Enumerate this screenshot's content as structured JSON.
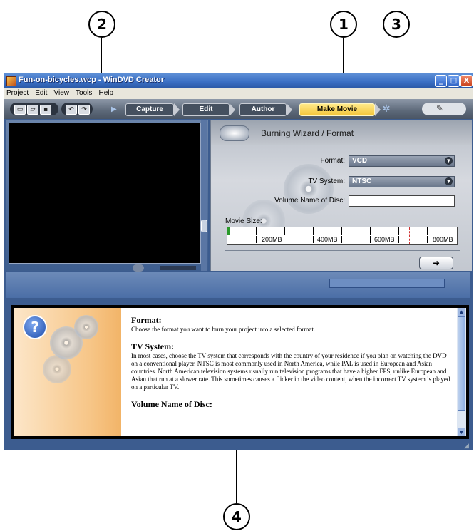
{
  "callouts": [
    "1",
    "2",
    "3",
    "4"
  ],
  "window": {
    "title": "Fun-on-bicycles.wcp - WinDVD Creator",
    "buttons": {
      "minimize": "_",
      "maximize": "□",
      "close": "X"
    }
  },
  "menu": [
    "Project",
    "Edit",
    "View",
    "Tools",
    "Help"
  ],
  "toolbar": {
    "file_buttons": [
      "new-icon",
      "open-icon",
      "save-icon"
    ],
    "undo_icon": "undo-icon",
    "redo_icon": "redo-icon",
    "steps": [
      {
        "label": "Capture",
        "active": false
      },
      {
        "label": "Edit",
        "active": false
      },
      {
        "label": "Author",
        "active": false
      },
      {
        "label": "Make Movie",
        "active": true
      }
    ]
  },
  "wizard": {
    "title": "Burning Wizard / Format",
    "format_label": "Format:",
    "format_value": "VCD",
    "tv_label": "TV System:",
    "tv_value": "NTSC",
    "volume_label": "Volume Name of Disc:",
    "volume_value": "",
    "movie_size_label": "Movie Size:",
    "size_marks": [
      "200MB",
      "400MB",
      "600MB",
      "800MB"
    ],
    "next_symbol": "➜"
  },
  "help": {
    "sections": [
      {
        "heading": "Format:",
        "body": "Choose the format you want to burn your project into a selected format."
      },
      {
        "heading": "TV System:",
        "body": "In most cases, choose the TV system that corresponds with the country of your residence if you plan on watching the DVD on a conventional player. NTSC is most commonly used in North America, while PAL is used in European and Asian countries. North American television systems usually run television programs that have a higher FPS, unlike European and Asian that run at a slower rate. This sometimes causes a flicker in the video content, when the incorrect TV system is played on a particular TV."
      },
      {
        "heading": "Volume Name of Disc:",
        "body": ""
      }
    ]
  },
  "colors": {
    "active_step": "#f3c53a",
    "window_bg": "#3c5c8f",
    "title_bar": "#3a6fc4"
  }
}
